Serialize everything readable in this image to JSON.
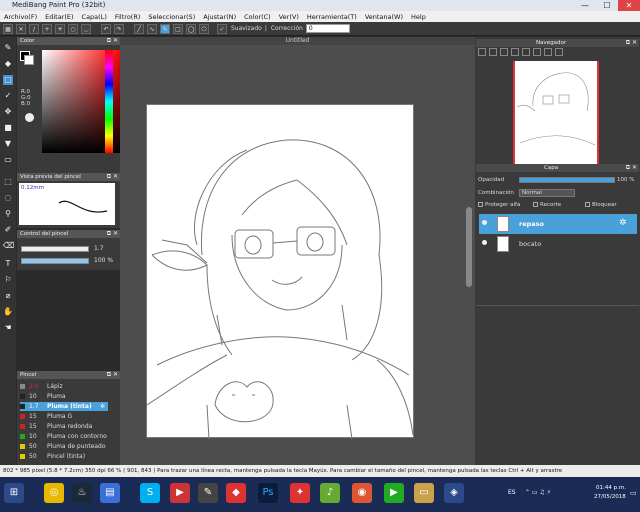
{
  "window": {
    "title": "MediBang Paint Pro (32bit)",
    "minimize": "—",
    "maximize": "☐",
    "close": "✕"
  },
  "menu": [
    "Archivo(F)",
    "Editar(E)",
    "Capa(L)",
    "Filtro(R)",
    "Seleccionar(S)",
    "Ajustar(N)",
    "Color(C)",
    "Ver(V)",
    "Herramienta(T)",
    "Ventana(W)",
    "Help"
  ],
  "toolbar": {
    "suavizado_label": "Suavizado",
    "correccion_label": "Corrección",
    "correccion_value": "0"
  },
  "canvas_tab": "Untitled",
  "color_panel": {
    "title": "Color",
    "r": "R:0",
    "g": "G:0",
    "b": "B:0"
  },
  "brush_preview": {
    "title": "Vista previa del pincel",
    "size": "0.12mm"
  },
  "brush_control": {
    "title": "Control del pincel",
    "size_value": "1.7",
    "opacity_value": "100 %"
  },
  "brush_panel": {
    "title": "Pincel",
    "items": [
      {
        "size": "2.0",
        "name": "Lápiz",
        "color": "#888888"
      },
      {
        "size": "10",
        "name": "Pluma",
        "color": "#222222"
      },
      {
        "size": "1.7",
        "name": "Pluma (tinta)",
        "color": "#222222"
      },
      {
        "size": "15",
        "name": "Pluma G",
        "color": "#cc2222"
      },
      {
        "size": "15",
        "name": "Pluma redonda",
        "color": "#cc2222"
      },
      {
        "size": "10",
        "name": "Pluma con contorno",
        "color": "#22aa22"
      },
      {
        "size": "50",
        "name": "Pluma de punteado",
        "color": "#ddcc00"
      },
      {
        "size": "50",
        "name": "Pincel (tinta)",
        "color": "#ddcc00"
      }
    ]
  },
  "navigator": {
    "title": "Navegador"
  },
  "layer_panel": {
    "title": "Capa",
    "opacity_label": "Opacidad",
    "opacity_value": "100 %",
    "blend_label": "Combinación",
    "blend_value": "Normal",
    "protect_alpha": "Proteger alfa",
    "clip": "Recorte",
    "lock": "Bloquear",
    "layers": [
      {
        "name": "repaso"
      },
      {
        "name": "bocato"
      }
    ]
  },
  "status": "802 * 985 pixel  (5.8 * 7.2cm)  350 dpi  66 %  ( 901, 843 )  Para trazar una línea recta, mantenga pulsada la tecla Mayús. Para cambiar el tamaño del pincel, mantenga pulsada las teclas Ctrl + Alt y arrastre",
  "taskbar": {
    "lang": "ES",
    "time": "01:44 p.m.",
    "date": "27/05/2018"
  }
}
